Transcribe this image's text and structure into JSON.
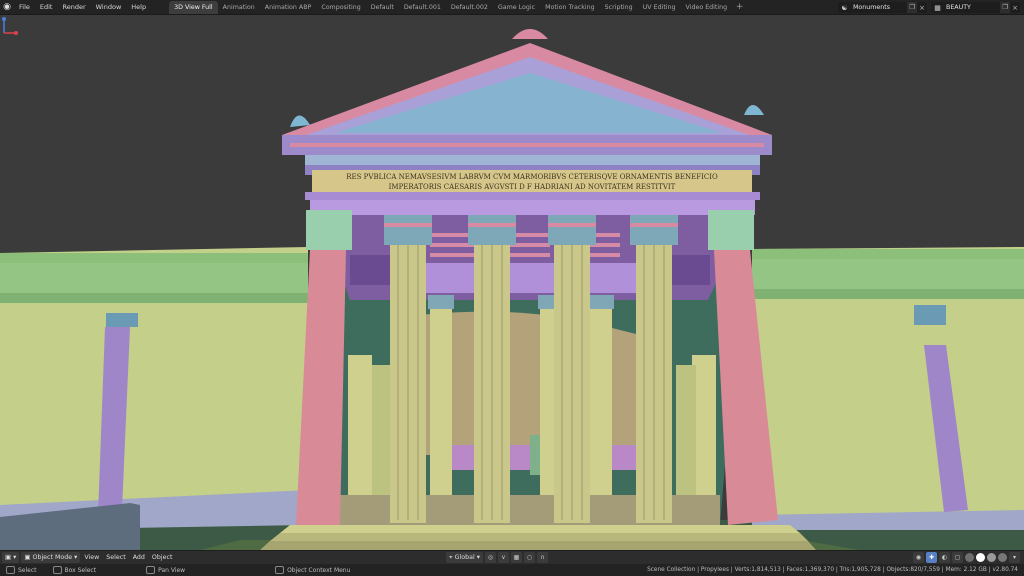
{
  "menu": [
    "File",
    "Edit",
    "Render",
    "Window",
    "Help"
  ],
  "workspaces": [
    {
      "label": "3D View Full",
      "active": true
    },
    {
      "label": "Animation",
      "active": false
    },
    {
      "label": "Animation ABP",
      "active": false
    },
    {
      "label": "Compositing",
      "active": false
    },
    {
      "label": "Default",
      "active": false
    },
    {
      "label": "Default.001",
      "active": false
    },
    {
      "label": "Default.002",
      "active": false
    },
    {
      "label": "Game Logic",
      "active": false
    },
    {
      "label": "Motion Tracking",
      "active": false
    },
    {
      "label": "Scripting",
      "active": false
    },
    {
      "label": "UV Editing",
      "active": false
    },
    {
      "label": "Video Editing",
      "active": false
    }
  ],
  "add_workspace": "+",
  "scene": {
    "name": "Monuments"
  },
  "view_layer": {
    "name": "BEAUTY"
  },
  "model": {
    "inscription_line1": "RES PVBLICA NEMAVSESIVM LABRVM CVM MARMORIBVS CETERISQVE ORNAMENTIS BENEFICIO",
    "inscription_line2": "IMPERATORIS CAESARIS AVGVSTI D F HADRIANI AD NOVITATEM RESTITVIT"
  },
  "header": {
    "mode": "Object Mode",
    "view": "View",
    "select": "Select",
    "add": "Add",
    "object": "Object",
    "transform_orientation": "Global"
  },
  "status": {
    "select": "Select",
    "box_select": "Box Select",
    "pan_view": "Pan View",
    "context_menu": "Object Context Menu",
    "stats": "Scene Collection | Propylees | Verts:1,814,513 | Faces:1,369,370 | Tris:1,905,728 | Objects:820/7,559 | Mem: 2.12 GB | v2.80.74"
  },
  "colors": {
    "pink": "#d98aa3",
    "blue": "#8fb3cf",
    "purple": "#a98ad1",
    "green": "#a9c98a",
    "yellow": "#cfcf8e",
    "accent": "#5680c2"
  }
}
